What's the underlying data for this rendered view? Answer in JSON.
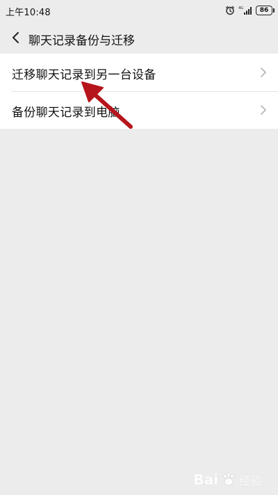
{
  "status_bar": {
    "time": "上午10:48",
    "network": "4G",
    "battery": "86",
    "alarm_icon": "alarm-clock-icon",
    "signal_icon": "signal-bars-icon"
  },
  "header": {
    "back_icon": "chevron-left-icon",
    "title": "聊天记录备份与迁移"
  },
  "menu": {
    "items": [
      {
        "label": "迁移聊天记录到另一台设备",
        "icon": "chevron-right-icon"
      },
      {
        "label": "备份聊天记录到电脑",
        "icon": "chevron-right-icon"
      }
    ]
  },
  "annotation": {
    "arrow_color": "#b5151b"
  },
  "watermark": {
    "brand": "Bai",
    "suffix": "经验"
  },
  "colors": {
    "background": "#ececec",
    "list_background": "#ffffff"
  }
}
